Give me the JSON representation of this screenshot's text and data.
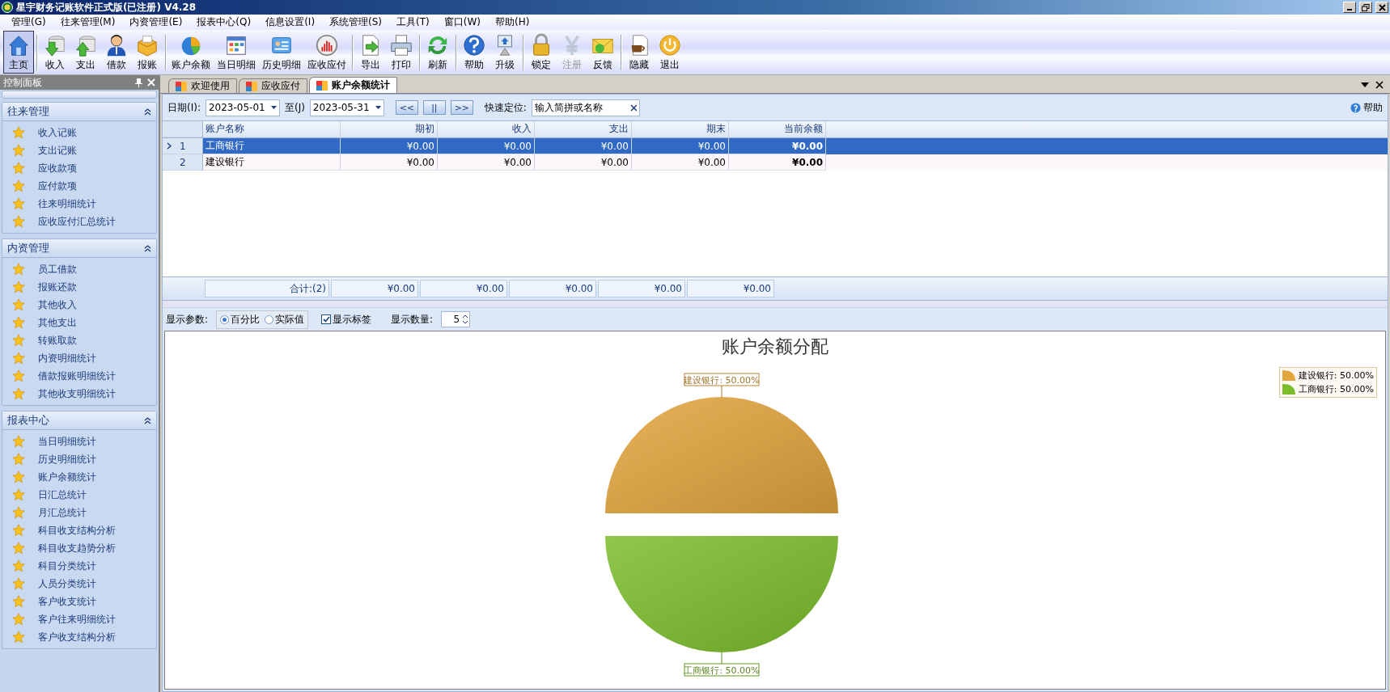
{
  "window": {
    "title": "星宇财务记账软件正式版(已注册) V4.28"
  },
  "menu": [
    "管理(G)",
    "往来管理(M)",
    "内资管理(E)",
    "报表中心(Q)",
    "信息设置(I)",
    "系统管理(S)",
    "工具(T)",
    "窗口(W)",
    "帮助(H)"
  ],
  "toolbar": [
    [
      {
        "label": "主页",
        "kind": "home",
        "selected": true,
        "disabled": false
      }
    ],
    [
      {
        "label": "收入",
        "kind": "in",
        "selected": false,
        "disabled": false
      },
      {
        "label": "支出",
        "kind": "out",
        "selected": false,
        "disabled": false
      },
      {
        "label": "借款",
        "kind": "person",
        "selected": false,
        "disabled": false
      },
      {
        "label": "报账",
        "kind": "box",
        "selected": false,
        "disabled": false
      }
    ],
    [
      {
        "label": "账户余额",
        "kind": "pie",
        "selected": false,
        "disabled": false
      },
      {
        "label": "当日明细",
        "kind": "calendar",
        "selected": false,
        "disabled": false
      },
      {
        "label": "历史明细",
        "kind": "card",
        "selected": false,
        "disabled": false
      },
      {
        "label": "应收应付",
        "kind": "gauge",
        "selected": false,
        "disabled": false
      }
    ],
    [
      {
        "label": "导出",
        "kind": "export",
        "selected": false,
        "disabled": false
      },
      {
        "label": "打印",
        "kind": "printer",
        "selected": false,
        "disabled": false
      }
    ],
    [
      {
        "label": "刷新",
        "kind": "refresh",
        "selected": false,
        "disabled": false
      }
    ],
    [
      {
        "label": "帮助",
        "kind": "help",
        "selected": false,
        "disabled": false
      },
      {
        "label": "升级",
        "kind": "upgrade",
        "selected": false,
        "disabled": false
      }
    ],
    [
      {
        "label": "锁定",
        "kind": "lock",
        "selected": false,
        "disabled": false
      },
      {
        "label": "注册",
        "kind": "yen",
        "selected": false,
        "disabled": true
      },
      {
        "label": "反馈",
        "kind": "mail",
        "selected": false,
        "disabled": false
      }
    ],
    [
      {
        "label": "隐藏",
        "kind": "cup",
        "selected": false,
        "disabled": false
      },
      {
        "label": "退出",
        "kind": "power",
        "selected": false,
        "disabled": false
      }
    ]
  ],
  "sidebar": {
    "title": "控制面板",
    "sections": [
      {
        "title": "往来管理",
        "expanded": true,
        "items": [
          "收入记账",
          "支出记账",
          "应收款项",
          "应付款项",
          "往来明细统计",
          "应收应付汇总统计"
        ]
      },
      {
        "title": "内资管理",
        "expanded": true,
        "items": [
          "员工借款",
          "报账还款",
          "其他收入",
          "其他支出",
          "转账取款",
          "内资明细统计",
          "借款报账明细统计",
          "其他收支明细统计"
        ]
      },
      {
        "title": "报表中心",
        "expanded": true,
        "items": [
          "当日明细统计",
          "历史明细统计",
          "账户余额统计",
          "日汇总统计",
          "月汇总统计",
          "科目收支结构分析",
          "科目收支趋势分析",
          "科目分类统计",
          "人员分类统计",
          "客户收支统计",
          "客户往来明细统计",
          "客户收支结构分析"
        ]
      }
    ]
  },
  "tabs": [
    {
      "label": "欢迎使用",
      "selected": false
    },
    {
      "label": "应收应付",
      "selected": false
    },
    {
      "label": "账户余额统计",
      "selected": true
    }
  ],
  "filter": {
    "date_label": "日期(I):",
    "date_from": "2023-05-01",
    "to_label": "至(J)",
    "date_to": "2023-05-31",
    "nav_buttons": [
      "<<",
      "||",
      ">>"
    ],
    "search_label": "快速定位:",
    "search_placeholder": "输入简拼或名称",
    "help": "帮助"
  },
  "table": {
    "columns": [
      "账户名称",
      "期初",
      "收入",
      "支出",
      "期末",
      "当前余额"
    ],
    "rows": [
      {
        "index": "1",
        "selected": true,
        "cells": [
          "工商银行",
          "¥0.00",
          "¥0.00",
          "¥0.00",
          "¥0.00",
          "¥0.00"
        ]
      },
      {
        "index": "2",
        "selected": false,
        "cells": [
          "建设银行",
          "¥0.00",
          "¥0.00",
          "¥0.00",
          "¥0.00",
          "¥0.00"
        ]
      }
    ],
    "totals": [
      "合计:(2)",
      "¥0.00",
      "¥0.00",
      "¥0.00",
      "¥0.00",
      "¥0.00"
    ]
  },
  "display": {
    "label": "显示参数:",
    "modes": [
      {
        "label": "百分比",
        "selected": true
      },
      {
        "label": "实际值",
        "selected": false
      }
    ],
    "show_labels": {
      "label": "显示标签",
      "checked": true
    },
    "count_label": "显示数量:",
    "count": "5"
  },
  "chart": {
    "legend": [
      {
        "label": "建设银行: 50.00%",
        "color": "#e2a53c"
      },
      {
        "label": "工商银行: 50.00%",
        "color": "#7cbd2c"
      }
    ],
    "chart_data": {
      "type": "pie",
      "title": "账户余额分配",
      "values": [
        50,
        50
      ],
      "data_labels": true,
      "value_labels": [
        "建设银行: 50.00%",
        "工商银行: 50.00%"
      ]
    }
  }
}
